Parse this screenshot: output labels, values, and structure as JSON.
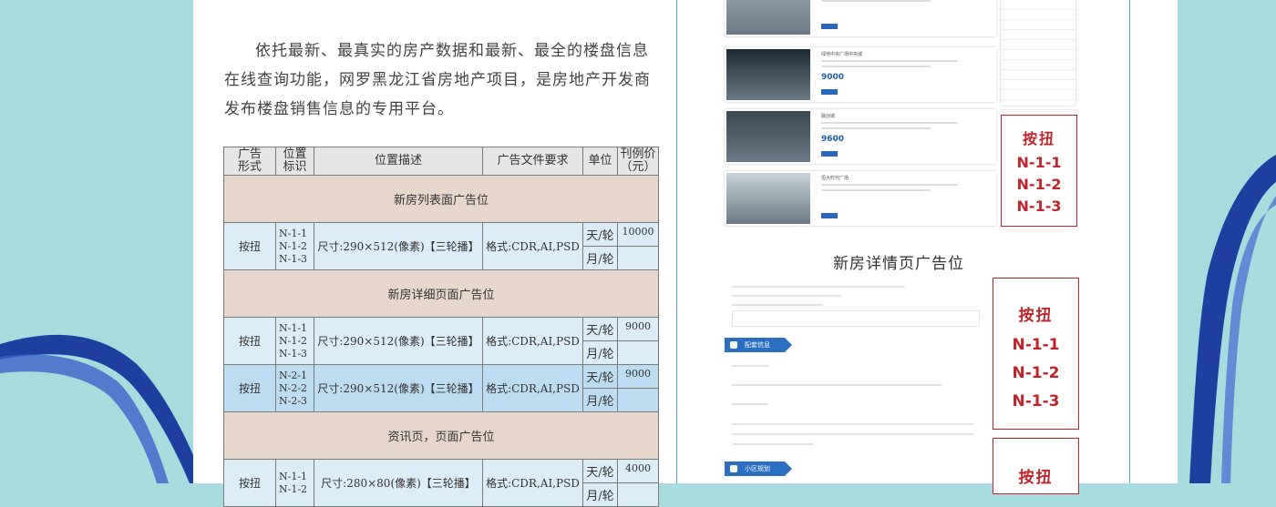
{
  "intro_text": "依托最新、最真实的房产数据和最新、最全的楼盘信息在线查询功能，网罗黑龙江省房地产项目，是房地产开发商发布楼盘销售信息的专用平台。",
  "table": {
    "headers": [
      "广告\n形式",
      "位置\n标识",
      "位置描述",
      "广告文件要求",
      "单位",
      "刊例价\n（元）"
    ],
    "sections": [
      {
        "title": "新房列表面广告位",
        "rows": [
          {
            "form": "按扭",
            "ids": "N-1-1\nN-1-2\nN-1-3",
            "desc": "尺寸:290×512(像素)【三轮播】",
            "req": "格式:CDR,AI,PSD",
            "units": [
              "天/轮",
              "月/轮"
            ],
            "prices": [
              "10000",
              ""
            ]
          }
        ]
      },
      {
        "title": "新房详细页面广告位",
        "rows": [
          {
            "form": "按扭",
            "ids": "N-1-1\nN-1-2\nN-1-3",
            "desc": "尺寸:290×512(像素)【三轮播】",
            "req": "格式:CDR,AI,PSD",
            "units": [
              "天/轮",
              "月/轮"
            ],
            "prices": [
              "9000",
              ""
            ]
          },
          {
            "form": "按扭",
            "ids": "N-2-1\nN-2-2\nN-2-3",
            "desc": "尺寸:290×512(像素)【三轮播】",
            "req": "格式:CDR,AI,PSD",
            "units": [
              "天/轮",
              "月/轮"
            ],
            "prices": [
              "9000",
              ""
            ]
          }
        ]
      },
      {
        "title": "资讯页，页面广告位",
        "rows": [
          {
            "form": "按扭",
            "ids": "N-1-1\nN-1-2",
            "desc": "尺寸:280×80(像素)【三轮播】",
            "req": "格式:CDR,AI,PSD",
            "units": [
              "天/轮",
              "月/轮"
            ],
            "prices": [
              "4000",
              ""
            ]
          }
        ]
      }
    ]
  },
  "preview": {
    "listings": [
      {
        "name": "",
        "price": "",
        "image": "building-photo"
      },
      {
        "name": "绿地中央广场中央城",
        "price": "9000",
        "image": "night-city-render"
      },
      {
        "name": "融创城",
        "price": "9600",
        "image": "residential-complex-render"
      },
      {
        "name": "恒大时代广场",
        "price": "",
        "image": "aerial-plan-render"
      }
    ],
    "btn_label": "按扭",
    "btn_ids": [
      "N-1-1",
      "N-1-2",
      "N-1-3"
    ],
    "detail_title": "新房详情页广告位",
    "band_labels": [
      "配套信息",
      "小区规划"
    ],
    "colors": {
      "accent_blue": "#2a6fc2",
      "button_red": "#c0232a",
      "background": "#a7dcde"
    }
  }
}
